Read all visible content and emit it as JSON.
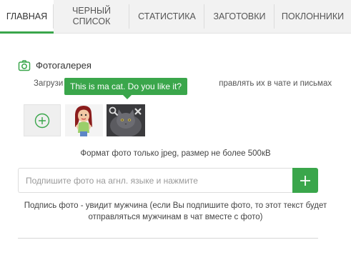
{
  "tabs": [
    {
      "label": "ГЛАВНАЯ",
      "active": true
    },
    {
      "label": "ЧЕРНЫЙ СПИСОК",
      "active": false
    },
    {
      "label": "СТАТИСТИКА",
      "active": false
    },
    {
      "label": "ЗАГОТОВКИ",
      "active": false
    },
    {
      "label": "ПОКЛОННИКИ",
      "active": false
    }
  ],
  "gallery": {
    "title": "Фотогалерея",
    "hint_start": "Загрузи",
    "hint_end": "правлять их в чате и письмах",
    "tooltip": "This is ma cat. Do you like it?",
    "photos": [
      {
        "subject": "cartoon girl avatar"
      },
      {
        "subject": "gray cat"
      }
    ],
    "format_note": "Формат фото только jpeg, размер не более 500кВ"
  },
  "caption": {
    "placeholder": "Подпишите фото на агнл. языке и нажмите",
    "value": "",
    "note": "Подпись фото - увидит мужчина (если Вы подпишите фото, то этот текст будет отправляться мужчинам в чат вместе с фото)"
  },
  "colors": {
    "accent": "#3aa64b",
    "tab_bar": "#f2f2f2"
  },
  "icons": {
    "section": "camera-icon",
    "add": "plus-circle-icon",
    "zoom": "magnifier-icon",
    "delete": "close-icon",
    "submit": "plus-icon"
  }
}
